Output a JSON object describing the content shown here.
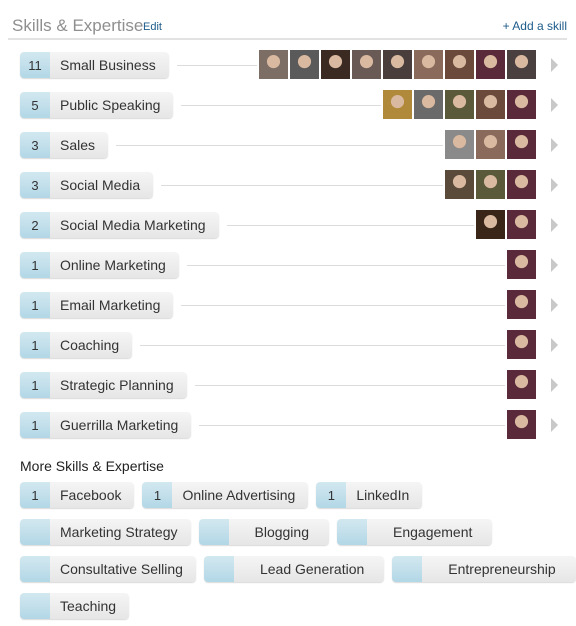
{
  "header": {
    "title": "Skills & Expertise",
    "edit_label": "Edit",
    "add_skill_label": "+ Add a skill"
  },
  "skills": [
    {
      "count": "11",
      "name": "Small Business",
      "avatars": [
        "#7c6e65",
        "#5a5a5a",
        "#3a2a22",
        "#6a5a55",
        "#4a3e3c",
        "#8a6a5a",
        "#6b4a3c",
        "#5a2a3a",
        "#4a4040"
      ]
    },
    {
      "count": "5",
      "name": "Public Speaking",
      "avatars": [
        "#b08a3a",
        "#6a6a6a",
        "#5a5a3a",
        "#6b4a3c",
        "#5a2a3a"
      ]
    },
    {
      "count": "3",
      "name": "Sales",
      "avatars": [
        "#8a8a8a",
        "#8a6a5a",
        "#5a2a3a"
      ]
    },
    {
      "count": "3",
      "name": "Social Media",
      "avatars": [
        "#5a4a3a",
        "#5a5a3a",
        "#5a2a3a"
      ]
    },
    {
      "count": "2",
      "name": "Social Media Marketing",
      "avatars": [
        "#3a2618",
        "#5a2a3a"
      ]
    },
    {
      "count": "1",
      "name": "Online Marketing",
      "avatars": [
        "#5a2a3a"
      ]
    },
    {
      "count": "1",
      "name": "Email Marketing",
      "avatars": [
        "#5a2a3a"
      ]
    },
    {
      "count": "1",
      "name": "Coaching",
      "avatars": [
        "#5a2a3a"
      ]
    },
    {
      "count": "1",
      "name": "Strategic Planning",
      "avatars": [
        "#5a2a3a"
      ]
    },
    {
      "count": "1",
      "name": "Guerrilla Marketing",
      "avatars": [
        "#5a2a3a"
      ]
    }
  ],
  "more": {
    "title": "More Skills & Expertise",
    "rows": [
      [
        {
          "count": "1",
          "name": "Facebook"
        },
        {
          "count": "1",
          "name": "Online Advertising"
        },
        {
          "count": "1",
          "name": "LinkedIn"
        }
      ],
      [
        {
          "count": "",
          "name": "Marketing Strategy"
        },
        {
          "count": "",
          "name": "Blogging"
        },
        {
          "count": "",
          "name": "Engagement"
        }
      ],
      [
        {
          "count": "",
          "name": "Consultative Selling"
        },
        {
          "count": "",
          "name": "Lead Generation"
        },
        {
          "count": "",
          "name": "Entrepreneurship"
        }
      ],
      [
        {
          "count": "",
          "name": "Teaching"
        }
      ]
    ]
  },
  "colors": {
    "accent_link": "#1c5b8a",
    "count_bg": "#b2d7e6"
  }
}
